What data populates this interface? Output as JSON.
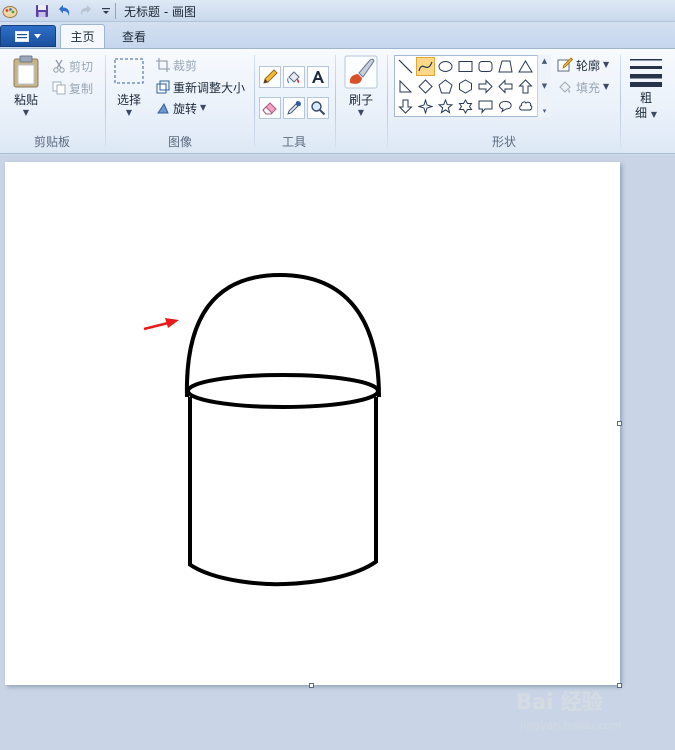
{
  "window": {
    "title": "无标题 - 画图"
  },
  "tabs": {
    "home": "主页",
    "view": "查看"
  },
  "groups": {
    "clipboard": {
      "label": "剪贴板",
      "paste": "粘贴",
      "cut": "剪切",
      "copy": "复制"
    },
    "image": {
      "label": "图像",
      "select": "选择",
      "crop": "裁剪",
      "resize": "重新调整大小",
      "rotate": "旋转"
    },
    "tools": {
      "label": "工具"
    },
    "brushes": {
      "label": "刷子"
    },
    "shapes": {
      "label": "形状",
      "outline": "轮廓",
      "fill": "填充"
    },
    "size": {
      "label_line1": "粗",
      "label_line2": "细"
    }
  },
  "colors": {
    "accent": "#1b4f9f",
    "arrow": "#e81a1a",
    "ink": "#000000",
    "selected_shape": "#fbd987"
  },
  "watermark": {
    "logo": "Bai 经验",
    "url": "jingyan.baidu.com"
  }
}
